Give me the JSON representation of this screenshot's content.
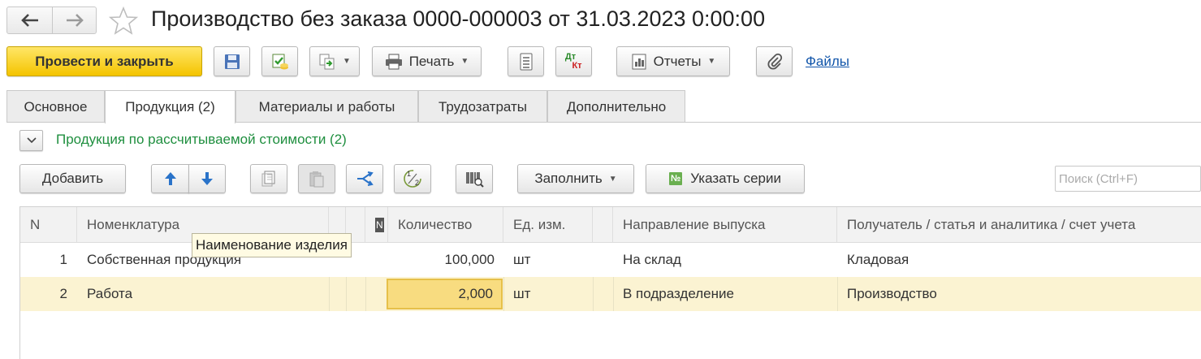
{
  "header": {
    "title": "Производство без заказа 0000-000003 от 31.03.2023 0:00:00",
    "back_icon": "arrow-left",
    "forward_icon": "arrow-right",
    "favorite_icon": "star"
  },
  "toolbar": {
    "post_close_label": "Провести и закрыть",
    "print_label": "Печать",
    "reports_label": "Отчеты",
    "files_label": "Файлы",
    "dtkt_top": "Дт",
    "dtkt_bottom": "Кт"
  },
  "tabs": [
    {
      "label": "Основное",
      "active": false
    },
    {
      "label": "Продукция (2)",
      "active": true
    },
    {
      "label": "Материалы и работы",
      "active": false
    },
    {
      "label": "Трудозатраты",
      "active": false
    },
    {
      "label": "Дополнительно",
      "active": false
    }
  ],
  "group": {
    "title": "Продукция по рассчитываемой стоимости (2)"
  },
  "table_toolbar": {
    "add_label": "Добавить",
    "fill_label": "Заполнить",
    "series_label": "Указать серии",
    "series_badge": "№",
    "search_placeholder": "Поиск (Ctrl+F)",
    "ratio_top": "1",
    "ratio_bottom": "2"
  },
  "table": {
    "columns": [
      "N",
      "Номенклатура",
      "N",
      "Количество",
      "Ед. изм.",
      "Направление выпуска",
      "Получатель / статья и аналитика / счет учета"
    ],
    "rows": [
      {
        "n": "1",
        "item": "Собственная продукция",
        "qty": "100,000",
        "unit": "шт",
        "direction": "На склад",
        "recipient": "Кладовая"
      },
      {
        "n": "2",
        "item": "Работа",
        "qty": "2,000",
        "unit": "шт",
        "direction": "В подразделение",
        "recipient": "Производство"
      }
    ],
    "tooltip": "Наименование изделия"
  },
  "colors": {
    "primary_button": "#f4c400",
    "selected_row": "#fbf3d2",
    "active_cell": "#f8dc80",
    "group_title": "#1f8f3f",
    "link": "#1155aa"
  }
}
